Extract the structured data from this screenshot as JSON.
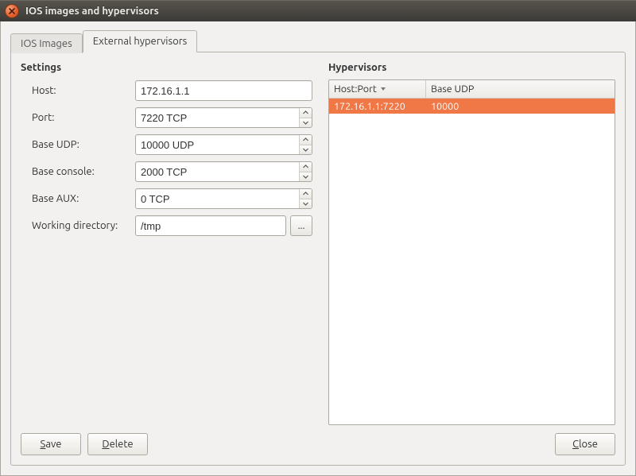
{
  "window": {
    "title": "IOS images and hypervisors"
  },
  "tabs": {
    "ios_images": {
      "label": "IOS Images"
    },
    "external_hypervisors": {
      "label": "External hypervisors"
    }
  },
  "settings": {
    "title": "Settings",
    "host_label": "Host:",
    "host_value": "172.16.1.1",
    "port_label": "Port:",
    "port_value": "7220 TCP",
    "base_udp_label": "Base UDP:",
    "base_udp_value": "10000 UDP",
    "base_console_label": "Base console:",
    "base_console_value": "2000 TCP",
    "base_aux_label": "Base AUX:",
    "base_aux_value": "0 TCP",
    "workdir_label": "Working directory:",
    "workdir_value": "/tmp",
    "browse_label": "..."
  },
  "hypervisors": {
    "title": "Hypervisors",
    "columns": {
      "hostport": "Host:Port",
      "baseudp": "Base UDP"
    },
    "rows": [
      {
        "hostport": "172.16.1.1:7220",
        "baseudp": "10000"
      }
    ]
  },
  "buttons": {
    "save_mn": "S",
    "save_rest": "ave",
    "delete_mn": "D",
    "delete_rest": "elete",
    "close_mn": "C",
    "close_rest": "lose"
  }
}
